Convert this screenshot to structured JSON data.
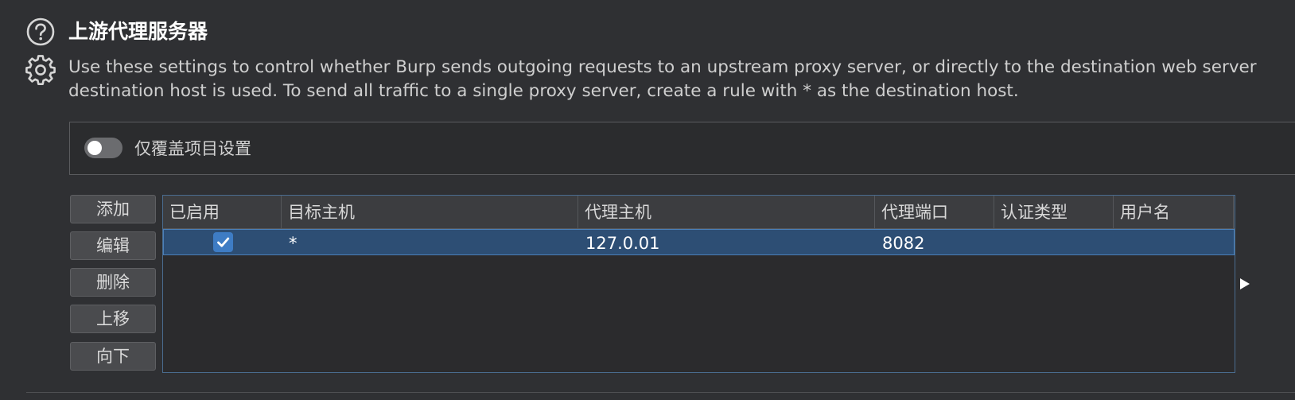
{
  "header": {
    "title": "上游代理服务器",
    "description_line1": "Use these settings to control whether Burp sends outgoing requests to an upstream proxy server, or directly to the destination web server",
    "description_line2": "destination host is used. To send all traffic to a single proxy server, create a rule with * as the destination host."
  },
  "override": {
    "label": "仅覆盖项目设置",
    "enabled": false
  },
  "buttons": {
    "add": "添加",
    "edit": "编辑",
    "remove": "删除",
    "up": "上移",
    "down": "向下"
  },
  "table": {
    "columns": [
      "已启用",
      "目标主机",
      "代理主机",
      "代理端口",
      "认证类型",
      "用户名"
    ],
    "rows": [
      {
        "enabled": true,
        "destination_host": "*",
        "proxy_host": "127.0.01",
        "proxy_port": "8082",
        "auth_type": "",
        "username": ""
      }
    ]
  },
  "colors": {
    "background": "#2f3033",
    "selected_row": "#2d4e74",
    "checkbox_accent": "#3e7cc4"
  },
  "icons": {
    "help": "help-circle-icon",
    "settings": "gear-icon",
    "scroll": "triangle-right-icon"
  }
}
